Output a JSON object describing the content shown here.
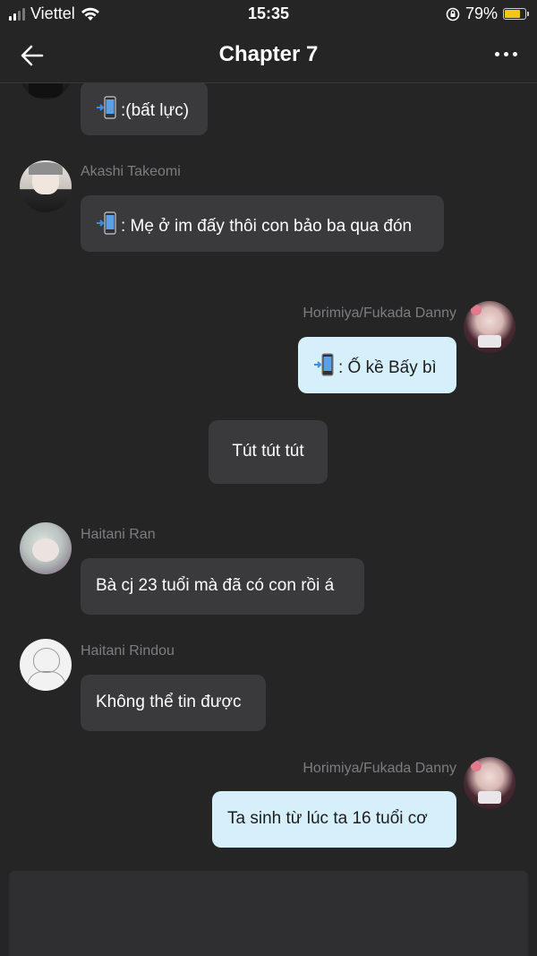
{
  "status_bar": {
    "carrier": "Viettel",
    "time": "15:35",
    "battery_percent": "79%",
    "battery_level": 0.79
  },
  "nav": {
    "title": "Chapter 7",
    "back_icon": "arrow-left-icon",
    "more_icon": "more-dots-icon"
  },
  "messages": [
    {
      "type": "other",
      "text": ":(bất lực)",
      "has_phone_emoji": true
    },
    {
      "type": "other",
      "sender": "Akashi Takeomi",
      "text": ": Mẹ ở im đấy thôi con bảo ba qua đón",
      "has_phone_emoji": true
    },
    {
      "type": "mine",
      "sender": "Horimiya/Fukada Danny",
      "text": ": Ố kề Bấy bì",
      "has_phone_emoji": true
    },
    {
      "type": "system",
      "text": "Tút tút tút"
    },
    {
      "type": "other",
      "sender": "Haitani Ran",
      "text": "Bà cj 23 tuổi mà đã có con rồi á"
    },
    {
      "type": "other",
      "sender": "Haitani Rindou",
      "text": "Không thể tin được"
    },
    {
      "type": "mine",
      "sender": "Horimiya/Fukada Danny",
      "text": "Ta sinh từ lúc ta 16 tuổi cơ"
    }
  ],
  "colors": {
    "background": "#252526",
    "bubble_other": "#3a3a3c",
    "bubble_mine": "#d6f0fb",
    "sender_name": "#7d7d80",
    "battery": "#f5c518"
  }
}
